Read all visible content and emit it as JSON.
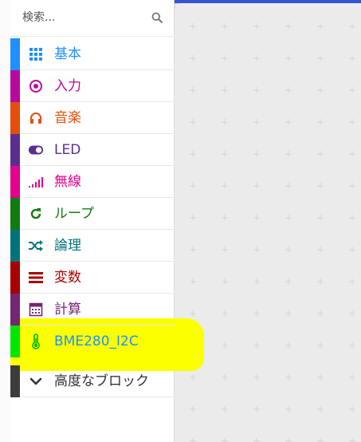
{
  "search": {
    "placeholder": "検索..."
  },
  "categories": [
    {
      "label": "基本",
      "color": "#1e90ff",
      "icon": "grid-icon"
    },
    {
      "label": "入力",
      "color": "#b8099e",
      "icon": "target-icon"
    },
    {
      "label": "音楽",
      "color": "#e34f0b",
      "icon": "headphones-icon"
    },
    {
      "label": "LED",
      "color": "#5c2d91",
      "icon": "toggle-icon"
    },
    {
      "label": "無線",
      "color": "#e3008c",
      "icon": "signal-icon"
    },
    {
      "label": "ループ",
      "color": "#107c10",
      "icon": "refresh-icon"
    },
    {
      "label": "論理",
      "color": "#00747a",
      "icon": "shuffle-icon"
    },
    {
      "label": "変数",
      "color": "#a80000",
      "icon": "list-icon"
    },
    {
      "label": "計算",
      "color": "#732673",
      "icon": "calculator-icon"
    },
    {
      "label": "BME280_I2C",
      "color": "#00e600",
      "icon": "thermometer-icon"
    },
    {
      "label": "高度なブロック",
      "color": "#3c3c3c",
      "icon": "chevron-down-icon"
    }
  ],
  "highlight_color": "#fbff00",
  "accent_color": "#3454d1"
}
